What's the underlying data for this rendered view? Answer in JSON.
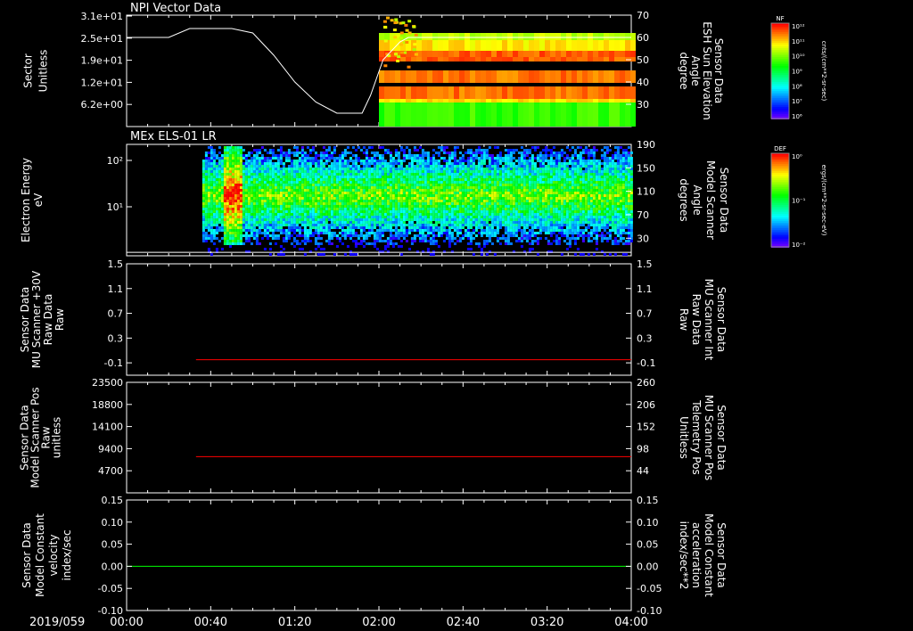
{
  "chart_data": [
    {
      "type": "heatmap",
      "title": "NPI Vector Data",
      "ylabel_left": [
        "Sector",
        "Unitless"
      ],
      "yticks_left": [
        "3.1e+01",
        "2.5e+01",
        "1.9e+01",
        "1.2e+01",
        "6.2e+00"
      ],
      "ylabel_right": [
        "Sensor Data",
        "ESH Sun Elevation",
        "Angle",
        "degree"
      ],
      "yticks_right": [
        70,
        60,
        50,
        40,
        30
      ],
      "ylim_right": [
        20,
        70
      ],
      "overlay_line": {
        "x": [
          "00:00",
          "00:12",
          "00:20",
          "00:30",
          "00:50",
          "01:00",
          "01:10",
          "01:20",
          "01:30",
          "01:40",
          "01:45",
          "01:52",
          "01:56",
          "02:02",
          "02:10",
          "02:14",
          "02:18",
          "04:00"
        ],
        "y": [
          60,
          60,
          60,
          64,
          64,
          62,
          52,
          40,
          31,
          26,
          26,
          26,
          34,
          50,
          58,
          60,
          60,
          60
        ]
      },
      "colorbar": {
        "label": "NF",
        "units": "cnts/(cm**2-sr-sec)",
        "ticks": [
          "10¹²",
          "10¹¹",
          "10¹⁰",
          "10⁹",
          "10⁸",
          "10⁷",
          "10⁶"
        ]
      },
      "data_start": "02:00"
    },
    {
      "type": "heatmap",
      "title": "MEx ELS-01 LR",
      "ylabel_left": [
        "Electron Energy",
        "eV"
      ],
      "yticks_left": [
        "10²",
        "10¹"
      ],
      "ylabel_right": [
        "Sensor Data",
        "Model Scanner",
        "Angle",
        "degrees"
      ],
      "yticks_right": [
        190,
        150,
        110,
        70,
        30
      ],
      "ylim_right": [
        0,
        190
      ],
      "overlay_line": {
        "x": [
          "00:00",
          "04:00"
        ],
        "y": [
          6,
          6
        ]
      },
      "colorbar": {
        "label": "DEF",
        "units": "ergs/(cm**2-sr-sec-eV)",
        "ticks": [
          "10⁰",
          "10⁻¹",
          "10⁻²"
        ]
      },
      "data_start": "00:36",
      "burst_start": "00:45",
      "burst_end": "00:55"
    },
    {
      "type": "line",
      "ylabel_left": [
        "Sensor Data",
        "MU Scanner +30V",
        "Raw Data",
        "Raw"
      ],
      "yticks_left": [
        "1.5",
        "1.1",
        "0.7",
        "0.3",
        "-0.1"
      ],
      "ylim": [
        -0.3,
        1.5
      ],
      "ylabel_right": [
        "Sensor Data",
        "MU Scanner Int",
        "Raw Data",
        "Raw"
      ],
      "yticks_right": [
        "1.5",
        "1.1",
        "0.7",
        "0.3",
        "-0.1"
      ],
      "series": [
        {
          "x": [
            "00:33",
            "04:00"
          ],
          "y": [
            -0.05,
            -0.05
          ],
          "color": "#ff0000"
        }
      ]
    },
    {
      "type": "line",
      "ylabel_left": [
        "Sensor Data",
        "Model Scanner Pos",
        "Raw",
        "unitless"
      ],
      "yticks_left": [
        "23500",
        "18800",
        "14100",
        "9400",
        "4700"
      ],
      "ylim": [
        0,
        23500
      ],
      "ylabel_right": [
        "Sensor Data",
        "MU Scanner Pos",
        "Telemetry Pos",
        "Unitless"
      ],
      "yticks_right": [
        "260",
        "206",
        "152",
        "98",
        "44"
      ],
      "series": [
        {
          "x": [
            "00:33",
            "04:00"
          ],
          "y": [
            7700,
            7700
          ],
          "color": "#ff0000"
        }
      ]
    },
    {
      "type": "line",
      "ylabel_left": [
        "Sensor Data",
        "Model Constant",
        "velocity",
        "index/sec"
      ],
      "yticks_left": [
        "0.15",
        "0.10",
        "0.05",
        "0.00",
        "-0.05",
        "-0.10"
      ],
      "ylim": [
        -0.1,
        0.15
      ],
      "ylabel_right": [
        "Sensor Data",
        "Model Constant",
        "acceleration",
        "index/sec**2"
      ],
      "yticks_right": [
        "0.15",
        "0.10",
        "0.05",
        "0.00",
        "-0.05",
        "-0.10"
      ],
      "series": [
        {
          "x": [
            "00:00",
            "04:00"
          ],
          "y": [
            0,
            0
          ],
          "color": "#00ff00"
        }
      ]
    }
  ],
  "xaxis": {
    "date_label": "2019/059",
    "ticks": [
      "00:00",
      "00:40",
      "01:20",
      "02:00",
      "02:40",
      "03:20",
      "04:00"
    ],
    "range": [
      "00:00",
      "04:00"
    ]
  },
  "colors": {
    "axis": "#ffffff",
    "background": "#000000",
    "right_label_red": "#ff0000",
    "right_label_green": "#00ff00"
  }
}
